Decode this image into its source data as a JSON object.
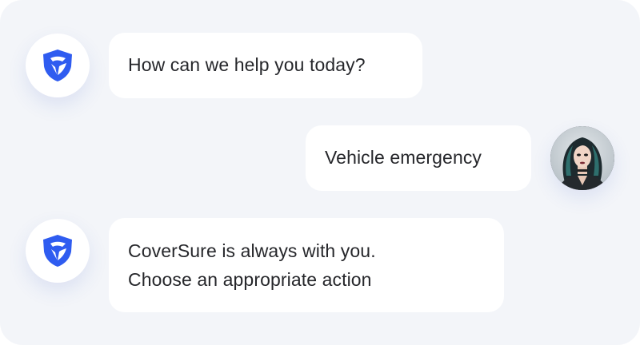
{
  "brand": {
    "accent": "#2f5cf0",
    "accent_dark": "#1e3fd6",
    "bot_icon": "shield-logo-icon"
  },
  "user": {
    "avatar_icon": "user-avatar-icon"
  },
  "messages": [
    {
      "sender": "bot",
      "lines": [
        "How can we help you today?"
      ]
    },
    {
      "sender": "user",
      "lines": [
        "Vehicle emergency"
      ]
    },
    {
      "sender": "bot",
      "lines": [
        "CoverSure is always with you.",
        "Choose an appropriate action"
      ]
    }
  ]
}
